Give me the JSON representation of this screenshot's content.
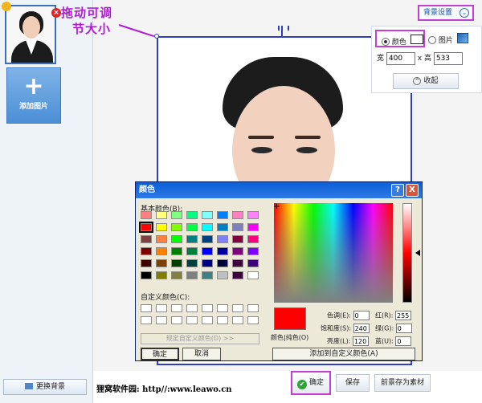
{
  "sidebar": {
    "add_picture_label": "添加图片",
    "change_background_label": "更换背景"
  },
  "hint": {
    "line1": "拖动可调",
    "line2": "节大小"
  },
  "settings": {
    "toggle_label": "背景设置",
    "color_label": "颜色",
    "picture_label": "图片",
    "width_label": "宽",
    "width_value": "400",
    "times": "x",
    "height_label": "高",
    "height_value": "533",
    "collapse_label": "收起",
    "swatch_color": "#ffffff"
  },
  "color_dialog": {
    "title": "颜色",
    "help": "?",
    "close": "X",
    "basic_colors_label": "基本颜色(B):",
    "custom_colors_label": "自定义颜色(C):",
    "define_custom_label": "规定自定义颜色(D) >>",
    "ok_label": "确定",
    "cancel_label": "取消",
    "preview_label": "颜色|纯色(O)",
    "hue_label": "色调(E):",
    "hue_value": "0",
    "sat_label": "饱和度(S):",
    "sat_value": "240",
    "lum_label": "亮度(L):",
    "lum_value": "120",
    "red_label": "红(R):",
    "red_value": "255",
    "green_label": "绿(G):",
    "green_value": "0",
    "blue_label": "蓝(U):",
    "blue_value": "0",
    "add_custom_label": "添加到自定义颜色(A)",
    "selected_color": "#ff0000",
    "basic_colors": [
      [
        "#ff8080",
        "#ffff80",
        "#80ff80",
        "#00ff80",
        "#80ffff",
        "#0080ff",
        "#ff80c0",
        "#ff80ff"
      ],
      [
        "#ff0000",
        "#ffff00",
        "#80ff00",
        "#00ff40",
        "#00ffff",
        "#0080c0",
        "#8080c0",
        "#ff00ff"
      ],
      [
        "#804040",
        "#ff8040",
        "#00ff00",
        "#008080",
        "#004080",
        "#8080ff",
        "#800040",
        "#ff0080"
      ],
      [
        "#800000",
        "#ff8000",
        "#008000",
        "#008040",
        "#0000ff",
        "#0000a0",
        "#800080",
        "#8000ff"
      ],
      [
        "#400000",
        "#804000",
        "#004000",
        "#004040",
        "#000080",
        "#000040",
        "#400040",
        "#400080"
      ],
      [
        "#000000",
        "#808000",
        "#808040",
        "#808080",
        "#408080",
        "#c0c0c0",
        "#400040",
        "#ffffff"
      ]
    ]
  },
  "footer": {
    "watermark": "狸窝软件园: http//:www.leawo.cn",
    "confirm_label": "确定",
    "save_label": "保存",
    "save_as_asset_label": "前景存为素材"
  }
}
